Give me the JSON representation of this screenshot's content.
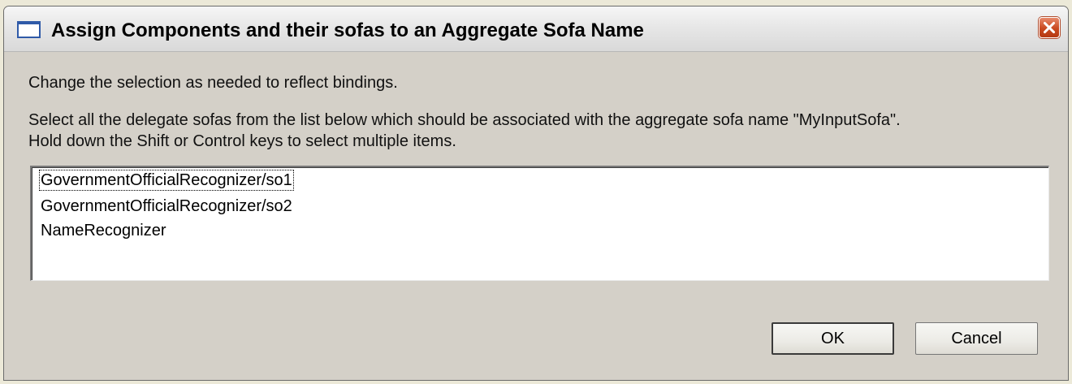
{
  "window": {
    "title": "Assign Components and their sofas to an Aggregate Sofa Name",
    "icons": {
      "app": "window-icon",
      "close": "close-icon"
    }
  },
  "instructions": {
    "line1": "Change the selection as needed to reflect bindings.",
    "line2": "Select all the delegate sofas from the list below which should be associated with the aggregate sofa name \"MyInputSofa\".",
    "line3": "Hold down the Shift or Control keys to select multiple items."
  },
  "list": {
    "items": [
      "GovernmentOfficialRecognizer/so1",
      "GovernmentOfficialRecognizer/so2",
      "NameRecognizer"
    ],
    "focused_index": 0
  },
  "buttons": {
    "ok": "OK",
    "cancel": "Cancel"
  },
  "colors": {
    "dialog_background": "#d4d0c8",
    "close_button": "#c9491f"
  }
}
